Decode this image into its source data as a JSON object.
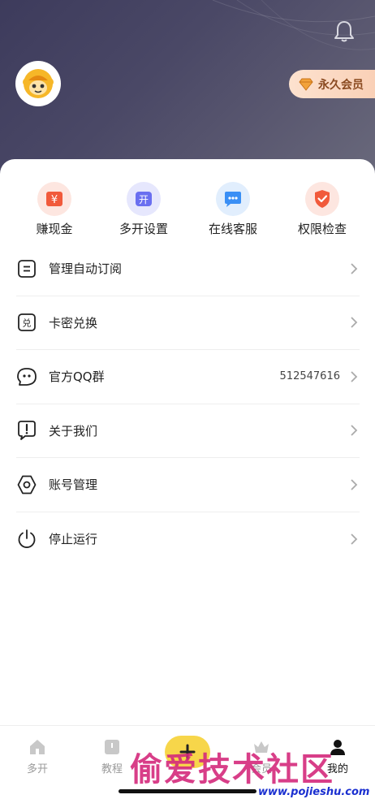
{
  "header": {
    "vip_label": "永久会员",
    "colors": {
      "bg_start": "#3d3b5c",
      "bg_end": "#6a6a7c",
      "vip_text": "#8a4a20"
    },
    "icons": {
      "bell": "bell-icon",
      "avatar": "monkey-avatar-icon",
      "vip": "diamond-icon"
    }
  },
  "quick_actions": [
    {
      "label": "赚现金",
      "icon": "yuan-icon",
      "color": "#f15a3b",
      "bg": "#fde6e0"
    },
    {
      "label": "多开设置",
      "icon": "open-icon",
      "color": "#6a6ff0",
      "bg": "#e6e7fd"
    },
    {
      "label": "在线客服",
      "icon": "chat-icon",
      "color": "#3a8ff5",
      "bg": "#e1eefd"
    },
    {
      "label": "权限检查",
      "icon": "shield-check-icon",
      "color": "#f15a3b",
      "bg": "#fde6e0"
    }
  ],
  "menu": [
    {
      "label": "管理自动订阅",
      "icon": "list-icon",
      "value": ""
    },
    {
      "label": "卡密兑换",
      "icon": "redeem-icon",
      "value": ""
    },
    {
      "label": "官方QQ群",
      "icon": "qq-icon",
      "value": "512547616"
    },
    {
      "label": "关于我们",
      "icon": "info-icon",
      "value": ""
    },
    {
      "label": "账号管理",
      "icon": "settings-icon",
      "value": ""
    },
    {
      "label": "停止运行",
      "icon": "power-icon",
      "value": ""
    }
  ],
  "tabbar": {
    "tabs": [
      {
        "label": "多开",
        "icon": "home-icon"
      },
      {
        "label": "教程",
        "icon": "book-icon"
      },
      {
        "label": "",
        "icon": "add-icon"
      },
      {
        "label": "会员",
        "icon": "crown-icon"
      },
      {
        "label": "我的",
        "icon": "user-icon"
      }
    ],
    "accent": "#f7d64a"
  },
  "watermark": {
    "text": "偷爱技术社区",
    "url": "www.pojieshu.com"
  }
}
